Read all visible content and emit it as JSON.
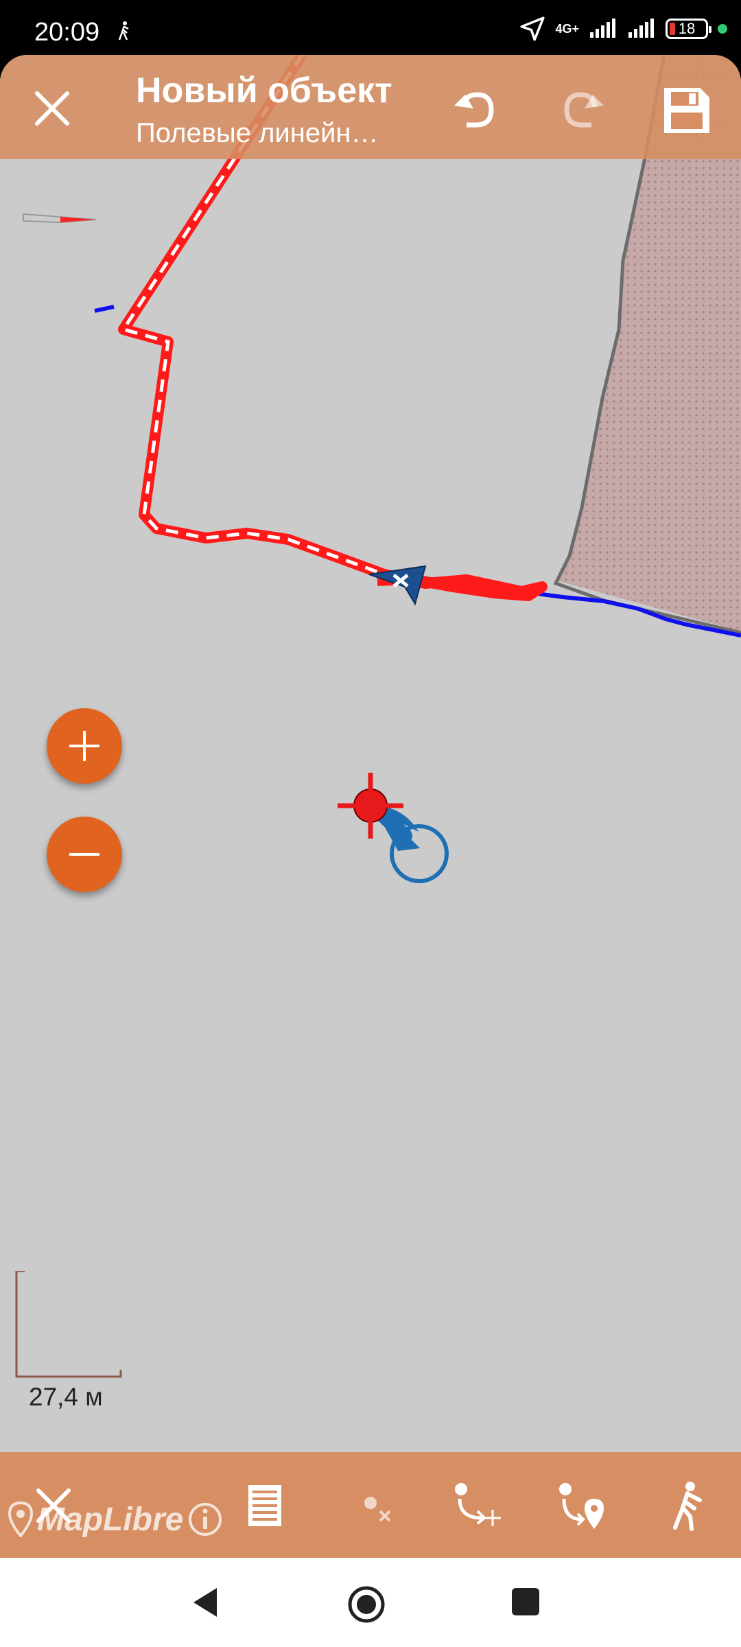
{
  "status_bar": {
    "time": "20:09",
    "network": "4G+",
    "battery": "18"
  },
  "toolbar": {
    "title": "Новый объект",
    "subtitle": "Полевые линейн…",
    "icons": [
      "close-icon",
      "undo-icon",
      "redo-icon",
      "save-icon"
    ]
  },
  "map": {
    "zoom_in_label": "+",
    "zoom_out_label": "−",
    "scale_label": "27,4 м",
    "colors": {
      "background": "#cbcbcb",
      "track_red": "#ff1a1a",
      "track_blue": "#1010ee",
      "area_fill": "#c6a8a8",
      "accent": "#e0641f"
    }
  },
  "bottom_bar": {
    "icons": [
      "close-icon",
      "list-icon",
      "delete-point-icon",
      "add-vertex-icon",
      "add-point-on-location-icon",
      "walk-mode-icon"
    ],
    "attribution": "MapLibre"
  },
  "navigation_bar": {
    "icons": [
      "back-icon",
      "home-icon",
      "recents-icon"
    ]
  }
}
